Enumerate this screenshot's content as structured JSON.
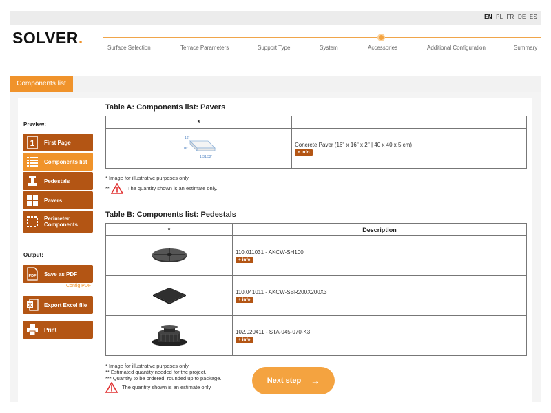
{
  "languages": [
    {
      "code": "EN",
      "active": true
    },
    {
      "code": "PL",
      "active": false
    },
    {
      "code": "FR",
      "active": false
    },
    {
      "code": "DE",
      "active": false
    },
    {
      "code": "ES",
      "active": false
    }
  ],
  "logo": {
    "text": "SOLVER",
    "dot": "."
  },
  "steps": [
    "Surface Selection",
    "Terrace Parameters",
    "Support Type",
    "System",
    "Accessories",
    "Additional Configuration",
    "Summary"
  ],
  "section_tab": "Components list",
  "sidebar": {
    "preview_heading": "Preview:",
    "preview_items": [
      "First Page",
      "Components list",
      "Pedestals",
      "Pavers",
      "Perimeter Components"
    ],
    "output_heading": "Output:",
    "output_items": [
      "Save as PDF",
      "Export Excel file",
      "Print"
    ],
    "config_pdf": "Config PDF"
  },
  "table_a": {
    "title": "Table A: Components list: Pavers",
    "header_col1": "*",
    "header_col2": "",
    "dims": {
      "top": "16\"",
      "side": "16\"",
      "thick": "1 31/32'"
    },
    "rows": [
      {
        "description": "Concrete Paver (16'' x 16'' x 2'' | 40 x 40 x 5 cm)",
        "info": "+ info"
      }
    ]
  },
  "notes_a": {
    "n1": "* Image for illustrative purposes only.",
    "n2_prefix": "**",
    "n2": "The quantity shown is an estimate only."
  },
  "table_b": {
    "title": "Table B: Components list: Pedestals",
    "header_col1": "*",
    "header_col2": "Description",
    "rows": [
      {
        "description": "110.011031 - AKCW-SH100",
        "info": "+ info"
      },
      {
        "description": "110.041011 - AKCW-SBR200X200X3",
        "info": "+ info"
      },
      {
        "description": "102.020411 - STA-045-070-K3",
        "info": "+ info"
      }
    ]
  },
  "notes_b": {
    "n1": "* Image for illustrative purposes only.",
    "n2": "** Estimated quantity needed for the project.",
    "n3": "*** Quantity to be ordered, rounded up to package.",
    "n4": "The quantity shown is an estimate only."
  },
  "next_button": {
    "label": "Next step",
    "arrow": "→"
  },
  "colors": {
    "accent": "#f0932b",
    "button_dark": "#b35514",
    "warning": "#e03030"
  }
}
